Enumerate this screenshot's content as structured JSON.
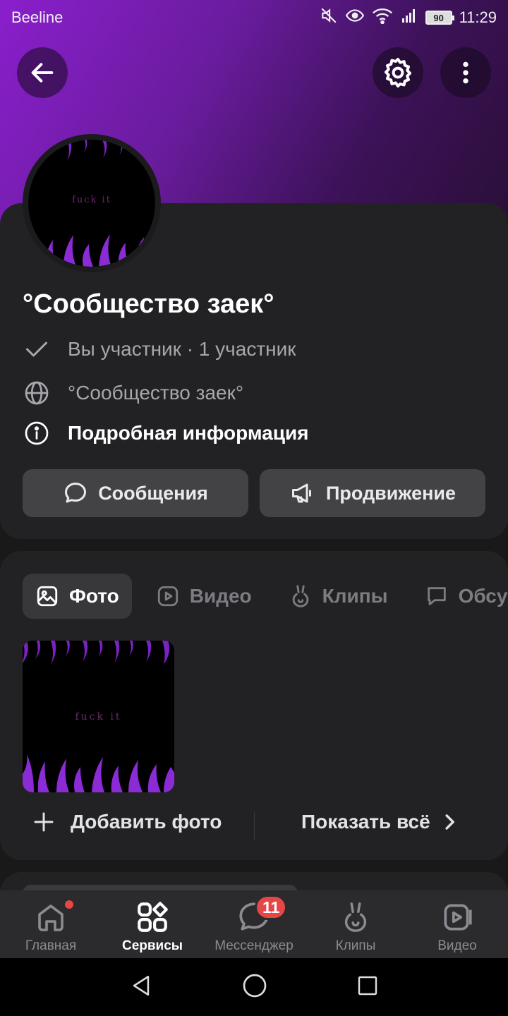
{
  "status_bar": {
    "carrier": "Beeline",
    "battery": "90",
    "time": "11:29"
  },
  "header": {
    "back_icon": "arrow-left-icon",
    "settings_icon": "gear-icon",
    "more_icon": "more-vertical-icon",
    "gradient_colors": [
      "#8a1fcc",
      "#3c1258"
    ]
  },
  "profile": {
    "avatar_caption": "fuck it",
    "title": "°Сообщество заек°",
    "membership": "Вы участник · 1 участник",
    "link": "°Сообщество заек°",
    "details": "Подробная информация",
    "messages_button": "Сообщения",
    "promo_button": "Продвижение"
  },
  "media": {
    "tabs": [
      {
        "label": "Фото",
        "icon": "image-icon"
      },
      {
        "label": "Видео",
        "icon": "video-icon"
      },
      {
        "label": "Клипы",
        "icon": "clips-icon"
      },
      {
        "label": "Обсуждения",
        "icon": "discussion-icon"
      }
    ],
    "photo_caption": "fuck it",
    "add_photo": "Добавить фото",
    "show_all": "Показать всё"
  },
  "bottom_nav": {
    "items": [
      {
        "label": "Главная",
        "icon": "home-icon"
      },
      {
        "label": "Сервисы",
        "icon": "services-icon"
      },
      {
        "label": "Мессенджер",
        "icon": "messenger-icon",
        "badge": "11"
      },
      {
        "label": "Клипы",
        "icon": "clips-icon"
      },
      {
        "label": "Видео",
        "icon": "video-icon"
      }
    ]
  },
  "colors": {
    "accent_flame": "#8b2bd6",
    "badge": "#e64646",
    "card": "#222224"
  }
}
